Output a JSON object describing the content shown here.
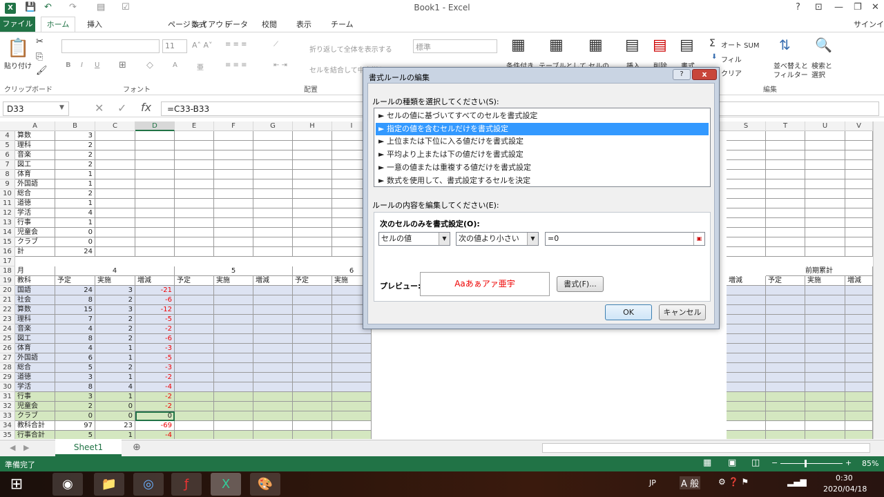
{
  "window": {
    "title": "Book1 - Excel",
    "signin": "サインイン"
  },
  "ribbon": {
    "tabs": [
      "ファイル",
      "ホーム",
      "挿入",
      "ページ レイアウト",
      "数式",
      "データ",
      "校閲",
      "表示",
      "チーム"
    ],
    "font_size": "11",
    "number_format": "標準",
    "paste": "貼り付け",
    "wrap": "折り返して全体を表示する",
    "merge": "セルを結合して中央揃え",
    "cond": "条件付き",
    "table": "テーブルとして",
    "cellstyle": "セルの",
    "insert": "挿入",
    "delete": "削除",
    "format": "書式",
    "autosum": "オート SUM",
    "fill": "フィル",
    "clear": "クリア",
    "sort": "並べ替えと",
    "sort2": "フィルター",
    "find": "検索と",
    "find2": "選択",
    "groups": {
      "clipboard": "クリップボード",
      "font": "フォント",
      "align": "配置",
      "edit": "編集"
    }
  },
  "formula_bar": {
    "name": "D33",
    "formula": "=C33-B33"
  },
  "columns": [
    "A",
    "B",
    "C",
    "D",
    "E",
    "F",
    "G",
    "H",
    "I",
    "S",
    "T",
    "U",
    "V"
  ],
  "rows_top": [
    {
      "n": "4",
      "a": "算数",
      "b": "3"
    },
    {
      "n": "5",
      "a": "理科",
      "b": "2"
    },
    {
      "n": "6",
      "a": "音楽",
      "b": "2"
    },
    {
      "n": "7",
      "a": "図工",
      "b": "2"
    },
    {
      "n": "8",
      "a": "体育",
      "b": "1"
    },
    {
      "n": "9",
      "a": "外国語",
      "b": "1"
    },
    {
      "n": "10",
      "a": "総合",
      "b": "2"
    },
    {
      "n": "11",
      "a": "道徳",
      "b": "1"
    },
    {
      "n": "12",
      "a": "学活",
      "b": "4"
    },
    {
      "n": "13",
      "a": "行事",
      "b": "1"
    },
    {
      "n": "14",
      "a": "児童会",
      "b": "0"
    },
    {
      "n": "15",
      "a": "クラブ",
      "b": "0"
    },
    {
      "n": "16",
      "a": "計",
      "b": "24"
    }
  ],
  "row18": {
    "n": "18",
    "a": "月",
    "m1": "4",
    "m2": "5",
    "m3": "6",
    "prev": "前期累計"
  },
  "row19": {
    "n": "19",
    "a": "教科",
    "h1": "予定",
    "h2": "実施",
    "h3": "増減"
  },
  "rows_bottom": [
    {
      "n": "20",
      "a": "国語",
      "b": "24",
      "c": "3",
      "d": "-21",
      "k": "blue"
    },
    {
      "n": "21",
      "a": "社会",
      "b": "8",
      "c": "2",
      "d": "-6",
      "k": "blue"
    },
    {
      "n": "22",
      "a": "算数",
      "b": "15",
      "c": "3",
      "d": "-12",
      "k": "blue"
    },
    {
      "n": "23",
      "a": "理科",
      "b": "7",
      "c": "2",
      "d": "-5",
      "k": "blue"
    },
    {
      "n": "24",
      "a": "音楽",
      "b": "4",
      "c": "2",
      "d": "-2",
      "k": "blue"
    },
    {
      "n": "25",
      "a": "図工",
      "b": "8",
      "c": "2",
      "d": "-6",
      "k": "blue"
    },
    {
      "n": "26",
      "a": "体育",
      "b": "4",
      "c": "1",
      "d": "-3",
      "k": "blue"
    },
    {
      "n": "27",
      "a": "外国語",
      "b": "6",
      "c": "1",
      "d": "-5",
      "k": "blue"
    },
    {
      "n": "28",
      "a": "総合",
      "b": "5",
      "c": "2",
      "d": "-3",
      "k": "blue"
    },
    {
      "n": "29",
      "a": "道徳",
      "b": "3",
      "c": "1",
      "d": "-2",
      "k": "blue"
    },
    {
      "n": "30",
      "a": "学活",
      "b": "8",
      "c": "4",
      "d": "-4",
      "k": "blue"
    },
    {
      "n": "31",
      "a": "行事",
      "b": "3",
      "c": "1",
      "d": "-2",
      "k": "green"
    },
    {
      "n": "32",
      "a": "児童会",
      "b": "2",
      "c": "0",
      "d": "-2",
      "k": "green"
    },
    {
      "n": "33",
      "a": "クラブ",
      "b": "0",
      "c": "0",
      "d": "0",
      "k": "green"
    },
    {
      "n": "34",
      "a": "教科合計",
      "b": "97",
      "c": "23",
      "d": "-69",
      "k": "white"
    },
    {
      "n": "35",
      "a": "行事合計",
      "b": "5",
      "c": "1",
      "d": "-4",
      "k": "green"
    }
  ],
  "sheet": {
    "tab": "Sheet1"
  },
  "status": {
    "text": "準備完了",
    "zoom": "85%"
  },
  "taskbar": {
    "ime": "JP",
    "kana": "A 般",
    "time": "0:30",
    "date": "2020/04/18"
  },
  "dialog": {
    "title": "書式ルールの編集",
    "help": "?",
    "close": "x",
    "select_label": "ルールの種類を選択してください(S):",
    "rules": [
      "► セルの値に基づいてすべてのセルを書式設定",
      "► 指定の値を含むセルだけを書式設定",
      "► 上位または下位に入る値だけを書式設定",
      "► 平均より上または下の値だけを書式設定",
      "► 一意の値または重複する値だけを書式設定",
      "► 数式を使用して、書式設定するセルを決定"
    ],
    "edit_label": "ルールの内容を編集してください(E):",
    "only_label": "次のセルのみを書式設定(O):",
    "cond1": "セルの値",
    "cond2": "次の値より小さい",
    "value": "=0",
    "preview_label": "プレビュー:",
    "preview_text": "Aaあぁアァ亜宇",
    "format_btn": "書式(F)...",
    "ok": "OK",
    "cancel": "キャンセル"
  }
}
